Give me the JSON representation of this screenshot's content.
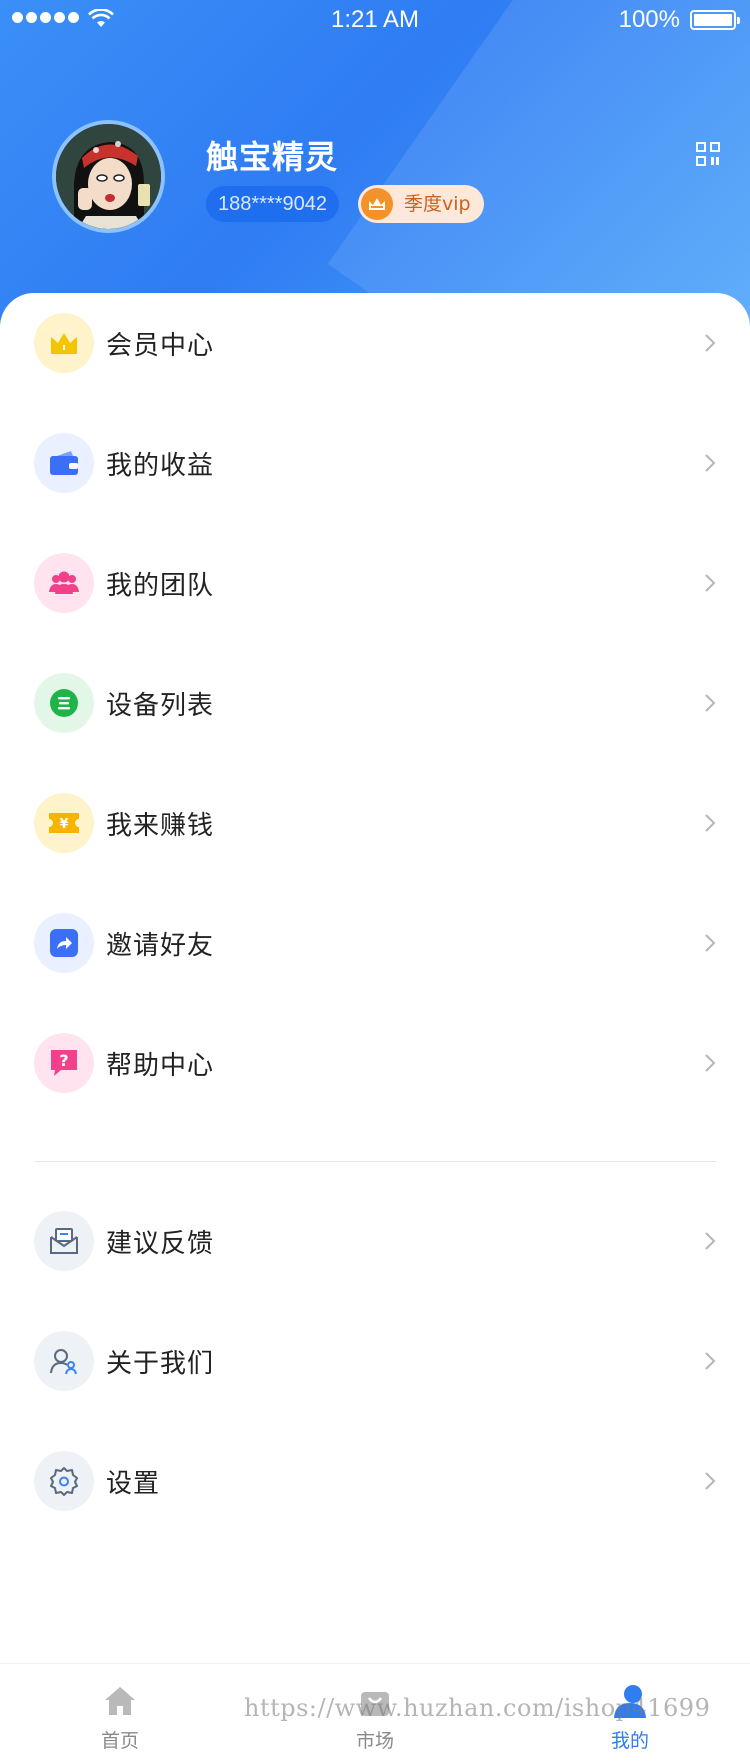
{
  "status_bar": {
    "time": "1:21 AM",
    "battery": "100%"
  },
  "profile": {
    "name": "触宝精灵",
    "phone": "188****9042",
    "vip_label": "季度vip"
  },
  "menu": {
    "group1": [
      {
        "label": "会员中心",
        "icon": "crown-icon",
        "color": "#f5c400",
        "bg": "#fff3cc"
      },
      {
        "label": "我的收益",
        "icon": "wallet-icon",
        "color": "#3b6ff5",
        "bg": "#eaf0ff"
      },
      {
        "label": "我的团队",
        "icon": "team-icon",
        "color": "#f0418a",
        "bg": "#ffe3ee"
      },
      {
        "label": "设备列表",
        "icon": "device-list-icon",
        "color": "#20b34a",
        "bg": "#e2f7e8"
      },
      {
        "label": "我来赚钱",
        "icon": "coupon-icon",
        "color": "#f6b400",
        "bg": "#fff3cc"
      },
      {
        "label": "邀请好友",
        "icon": "share-icon",
        "color": "#3b6ff5",
        "bg": "#eaf0ff"
      },
      {
        "label": "帮助中心",
        "icon": "help-icon",
        "color": "#f0418a",
        "bg": "#ffe3ee"
      }
    ],
    "group2": [
      {
        "label": "建议反馈",
        "icon": "feedback-icon",
        "color": "#5a6a80",
        "bg": "#eef1f6"
      },
      {
        "label": "关于我们",
        "icon": "about-icon",
        "color": "#5a6a80",
        "bg": "#eef1f6"
      },
      {
        "label": "设置",
        "icon": "settings-icon",
        "color": "#5a6a80",
        "bg": "#eef1f6"
      }
    ]
  },
  "tabbar": {
    "home": "首页",
    "market": "市场",
    "mine": "我的"
  },
  "watermark": "https://www.huzhan.com/ishop41699",
  "colors": {
    "primary": "#2f7cf3",
    "inactive": "#8a8a8a"
  }
}
